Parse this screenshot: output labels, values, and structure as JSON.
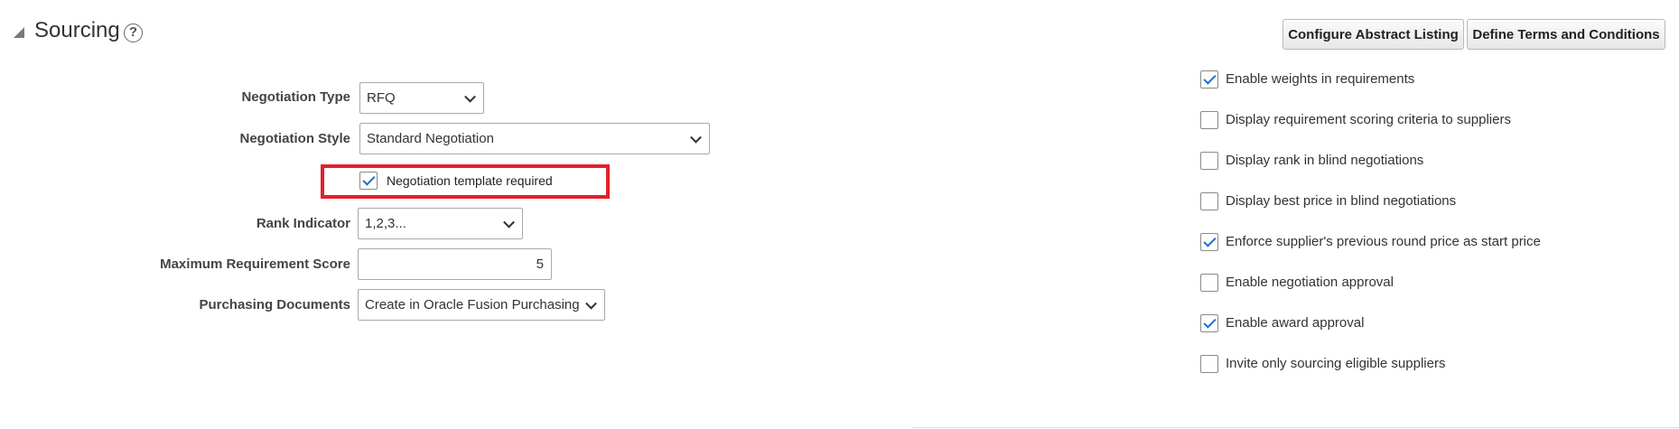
{
  "section": {
    "title": "Sourcing",
    "help_glyph": "?"
  },
  "buttons": {
    "configure_abstract": "Configure Abstract Listing",
    "define_terms": "Define Terms and Conditions"
  },
  "form": {
    "negotiation_type": {
      "label": "Negotiation Type",
      "value": "RFQ"
    },
    "negotiation_style": {
      "label": "Negotiation Style",
      "value": "Standard Negotiation"
    },
    "template_required": {
      "label": "Negotiation template required",
      "checked": true
    },
    "rank_indicator": {
      "label": "Rank Indicator",
      "value": "1,2,3..."
    },
    "max_requirement_score": {
      "label": "Maximum Requirement Score",
      "value": "5"
    },
    "purchasing_documents": {
      "label": "Purchasing Documents",
      "value": "Create in Oracle Fusion Purchasing"
    }
  },
  "options": [
    {
      "label": "Enable weights in requirements",
      "checked": true
    },
    {
      "label": "Display requirement scoring criteria to suppliers",
      "checked": false
    },
    {
      "label": "Display rank in blind negotiations",
      "checked": false
    },
    {
      "label": "Display best price in blind negotiations",
      "checked": false
    },
    {
      "label": "Enforce supplier's previous round price as start price",
      "checked": true
    },
    {
      "label": "Enable negotiation approval",
      "checked": false
    },
    {
      "label": "Enable award approval",
      "checked": true
    },
    {
      "label": "Invite only sourcing eligible suppliers",
      "checked": false
    }
  ],
  "colors": {
    "highlight": "#e3202a",
    "checkmark": "#1a73c9"
  }
}
